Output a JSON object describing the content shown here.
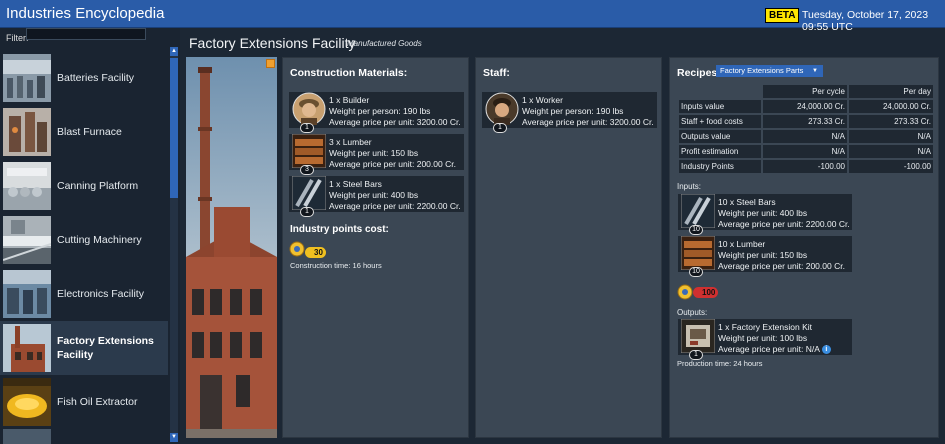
{
  "app": {
    "title": "Industries Encyclopedia",
    "beta_label": "BETA",
    "datetime": "Tuesday, October 17, 2023 09:55 UTC"
  },
  "sidebar": {
    "filter_label": "Filter:",
    "filter_value": "",
    "items": [
      {
        "label": "Batteries Facility",
        "icon": "batteries-facility-thumb"
      },
      {
        "label": "Blast Furnace",
        "icon": "blast-furnace-thumb"
      },
      {
        "label": "Canning Platform",
        "icon": "canning-platform-thumb"
      },
      {
        "label": "Cutting Machinery",
        "icon": "cutting-machinery-thumb"
      },
      {
        "label": "Electronics Facility",
        "icon": "electronics-facility-thumb"
      },
      {
        "label": "Factory Extensions Facility",
        "icon": "factory-extensions-thumb",
        "selected": true
      },
      {
        "label": "Fish Oil Extractor",
        "icon": "fish-oil-extractor-thumb"
      }
    ]
  },
  "facility": {
    "name": "Factory Extensions Facility",
    "category": "Manufactured Goods"
  },
  "construction": {
    "title": "Construction Materials:",
    "items": [
      {
        "line1": "1 x Builder",
        "line2": "Weight per person: 190 lbs",
        "line3": "Average price per unit: 3200.00 Cr.",
        "qty": "1",
        "icon": "builder-portrait-icon"
      },
      {
        "line1": "3 x Lumber",
        "line2": "Weight per unit: 150 lbs",
        "line3": "Average price per unit: 200.00 Cr.",
        "qty": "3",
        "icon": "lumber-icon"
      },
      {
        "line1": "1 x Steel Bars",
        "line2": "Weight per unit: 400 lbs",
        "line3": "Average price per unit: 2200.00 Cr.",
        "qty": "1",
        "icon": "steel-bars-icon"
      }
    ],
    "points_title": "Industry points cost:",
    "points_value": "30",
    "construction_time": "Construction time: 16 hours"
  },
  "staff": {
    "title": "Staff:",
    "items": [
      {
        "line1": "1 x Worker",
        "line2": "Weight per person: 190 lbs",
        "line3": "Average price per unit: 3200.00 Cr.",
        "qty": "1",
        "icon": "worker-portrait-icon"
      }
    ]
  },
  "recipes": {
    "title": "Recipes:",
    "selected": "Factory Extensions Parts",
    "columns": [
      "Per cycle",
      "Per day"
    ],
    "rows": [
      {
        "label": "Inputs value",
        "per_cycle": "24,000.00 Cr.",
        "per_day": "24,000.00 Cr."
      },
      {
        "label": "Staff + food costs",
        "per_cycle": "273.33 Cr.",
        "per_day": "273.33 Cr."
      },
      {
        "label": "Outputs value",
        "per_cycle": "N/A",
        "per_day": "N/A"
      },
      {
        "label": "Profit estimation",
        "per_cycle": "N/A",
        "per_day": "N/A"
      },
      {
        "label": "Industry Points",
        "per_cycle": "-100.00",
        "per_day": "-100.00"
      }
    ],
    "inputs_label": "Inputs:",
    "inputs": [
      {
        "line1": "10 x Steel Bars",
        "line2": "Weight per unit: 400 lbs",
        "line3": "Average price per unit: 2200.00 Cr.",
        "qty": "10",
        "icon": "steel-bars-icon"
      },
      {
        "line1": "10 x Lumber",
        "line2": "Weight per unit: 150 lbs",
        "line3": "Average price per unit: 200.00 Cr.",
        "qty": "10",
        "icon": "lumber-icon"
      }
    ],
    "points_value": "100",
    "outputs_label": "Outputs:",
    "outputs": [
      {
        "line1": "1 x Factory Extension Kit",
        "line2": "Weight per unit: 100 lbs",
        "line3": "Average price per unit: N/A",
        "qty": "1",
        "icon": "factory-extension-kit-icon"
      }
    ],
    "production_time": "Production time: 24 hours",
    "info_glyph": "i"
  },
  "colors": {
    "titlebar": "#2a5ca8",
    "accent": "#2f66b8",
    "beta": "#ffe600",
    "points_positive": "#f0c020",
    "points_negative": "#d03030"
  }
}
